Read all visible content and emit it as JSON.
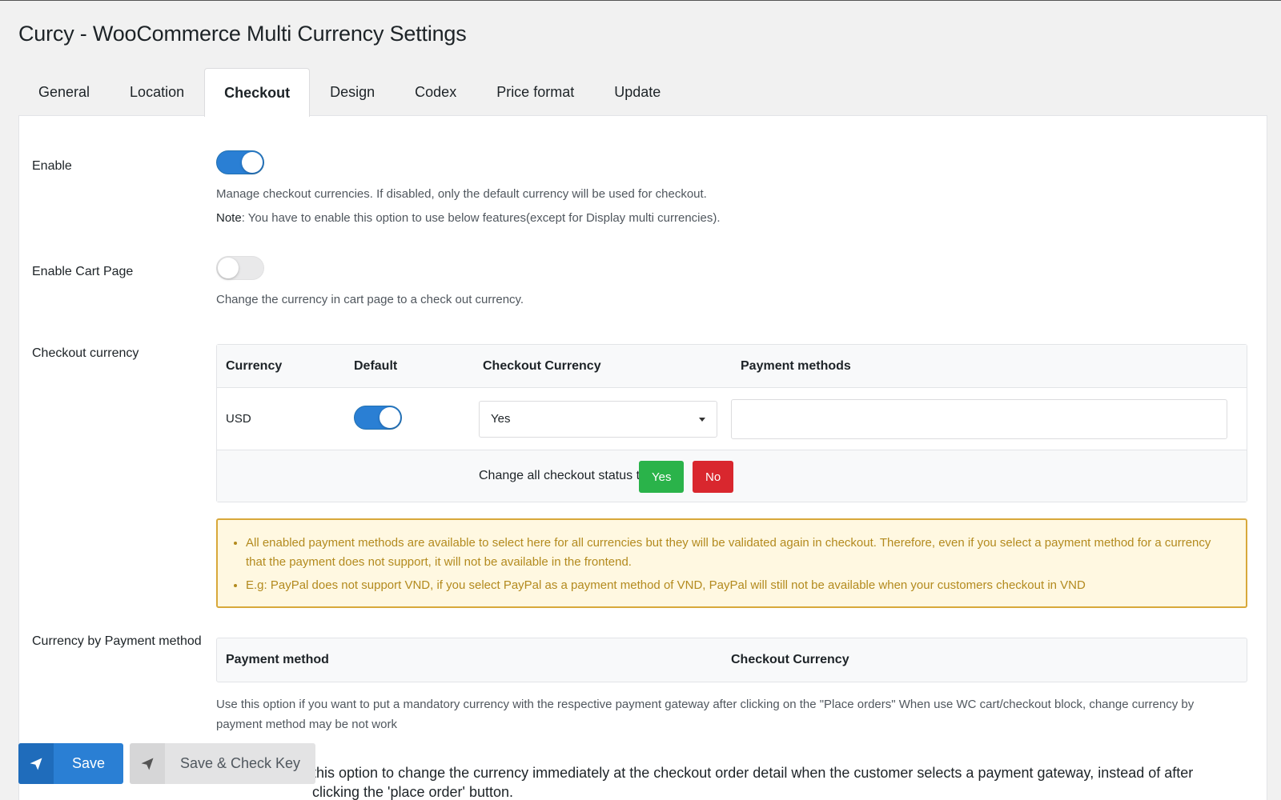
{
  "page": {
    "title": "Curcy - WooCommerce Multi Currency Settings"
  },
  "tabs": [
    {
      "label": "General",
      "active": false
    },
    {
      "label": "Location",
      "active": false
    },
    {
      "label": "Checkout",
      "active": true
    },
    {
      "label": "Design",
      "active": false
    },
    {
      "label": "Codex",
      "active": false
    },
    {
      "label": "Price format",
      "active": false
    },
    {
      "label": "Update",
      "active": false
    }
  ],
  "enable": {
    "label": "Enable",
    "checked": true,
    "desc": "Manage checkout currencies. If disabled, only the default currency will be used for checkout.",
    "note_prefix": "Note",
    "note_text": ": You have to enable this option to use below features(except for Display multi currencies)."
  },
  "enable_cart": {
    "label": "Enable Cart Page",
    "checked": false,
    "desc": "Change the currency in cart page to a check out currency."
  },
  "checkout_currency": {
    "label": "Checkout currency",
    "headers": {
      "currency": "Currency",
      "default": "Default",
      "checkout": "Checkout Currency",
      "payment": "Payment methods"
    },
    "row": {
      "currency": "USD",
      "default": true,
      "checkout_value": "Yes",
      "payment_value": ""
    },
    "change_all_label": "Change all checkout status to:",
    "yes_label": "Yes",
    "no_label": "No"
  },
  "notice": {
    "items": [
      "All enabled payment methods are available to select here for all currencies but they will be validated again in checkout. Therefore, even if you select a payment method for a currency that the payment does not support, it will not be available in the frontend.",
      "E.g: PayPal does not support VND, if you select PayPal as a payment method of VND, PayPal will still not be available when your customers checkout in VND"
    ]
  },
  "currency_by_payment": {
    "label": "Currency by Payment method",
    "headers": {
      "method": "Payment method",
      "checkout": "Checkout Currency"
    },
    "desc": "Use this option if you want to put a mandatory currency with the respective payment gateway after clicking on the \"Place orders\" When use WC cart/checkout block, change currency by payment method may be not work"
  },
  "instant_change": {
    "desc": "this option to change the currency immediately at the checkout order detail when the customer selects a payment gateway, instead of after clicking the 'place order' button."
  },
  "footer": {
    "save_label": "Save",
    "check_key_label": "Save & Check Key"
  },
  "colors": {
    "accent": "#2a7fd4",
    "yes_green": "#2ab34a",
    "no_red": "#d9272e",
    "notice_bg": "#fff8e1",
    "notice_border": "#d8a83a"
  }
}
